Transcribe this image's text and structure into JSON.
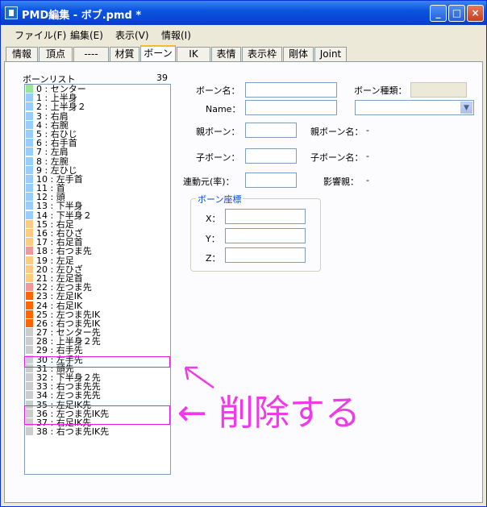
{
  "window": {
    "title": "PMD編集 - ボブ.pmd *",
    "minimize": "_",
    "maximize": "□",
    "close": "×"
  },
  "menu": [
    "ファイル(F)",
    "編集(E)",
    "表示(V)",
    "情報(I)"
  ],
  "tabs": [
    "情報",
    "頂点",
    "----",
    "材質",
    "ボーン",
    "IK",
    "表情",
    "表示枠",
    "剛体",
    "Joint"
  ],
  "active_tab": "ボーン",
  "bone_list": {
    "header": "ボーンリスト",
    "count": "39",
    "items": [
      {
        "label": "0 : センター",
        "color": "#99e699"
      },
      {
        "label": "1 : 上半身",
        "color": "#99ccff"
      },
      {
        "label": "2 : 上半身２",
        "color": "#99ccff"
      },
      {
        "label": "3 : 右肩",
        "color": "#99ccff"
      },
      {
        "label": "4 : 右腕",
        "color": "#99ccff"
      },
      {
        "label": "5 : 右ひじ",
        "color": "#99ccff"
      },
      {
        "label": "6 : 右手首",
        "color": "#99ccff"
      },
      {
        "label": "7 : 左肩",
        "color": "#99ccff"
      },
      {
        "label": "8 : 左腕",
        "color": "#99ccff"
      },
      {
        "label": "9 : 左ひじ",
        "color": "#99ccff"
      },
      {
        "label": "10 : 左手首",
        "color": "#99ccff"
      },
      {
        "label": "11 : 首",
        "color": "#99ccff"
      },
      {
        "label": "12 : 頭",
        "color": "#99ccff"
      },
      {
        "label": "13 : 下半身",
        "color": "#99ccff"
      },
      {
        "label": "14 : 下半身２",
        "color": "#99ccff"
      },
      {
        "label": "15 : 右足",
        "color": "#ffcc80"
      },
      {
        "label": "16 : 右ひざ",
        "color": "#ffcc80"
      },
      {
        "label": "17 : 右足首",
        "color": "#ffcc80"
      },
      {
        "label": "18 : 右つま先",
        "color": "#f09999"
      },
      {
        "label": "19 : 左足",
        "color": "#ffcc80"
      },
      {
        "label": "20 : 左ひざ",
        "color": "#ffcc80"
      },
      {
        "label": "21 : 左足首",
        "color": "#ffcc80"
      },
      {
        "label": "22 : 左つま先",
        "color": "#f09999"
      },
      {
        "label": "23 : 左足IK",
        "color": "#ff6600"
      },
      {
        "label": "24 : 右足IK",
        "color": "#ff6600"
      },
      {
        "label": "25 : 左つま先IK",
        "color": "#ff6600"
      },
      {
        "label": "26 : 右つま先IK",
        "color": "#ff6600"
      },
      {
        "label": "27 : センター先",
        "color": "#cccccc"
      },
      {
        "label": "28 : 上半身２先",
        "color": "#cccccc"
      },
      {
        "label": "29 : 右手先",
        "color": "#cccccc"
      },
      {
        "label": "30 : 左手先",
        "color": "#cccccc"
      },
      {
        "label": "31 : 頭先",
        "color": "#cccccc"
      },
      {
        "label": "32 : 下半身２先",
        "color": "#cccccc"
      },
      {
        "label": "33 : 右つま先先",
        "color": "#cccccc"
      },
      {
        "label": "34 : 左つま先先",
        "color": "#cccccc"
      },
      {
        "label": "35 : 左足IK先",
        "color": "#cccccc"
      },
      {
        "label": "36 : 左つま先IK先",
        "color": "#cccccc"
      },
      {
        "label": "37 : 右足IK先",
        "color": "#cccccc"
      },
      {
        "label": "38 : 右つま先IK先",
        "color": "#cccccc"
      }
    ]
  },
  "form": {
    "bone_name_label": "ボーン名：",
    "bone_name_value": "",
    "bone_type_label": "ボーン種類：",
    "name_label": "Name：",
    "name_value": "",
    "parent_label": "親ボーン：",
    "parent_name_label": "親ボーン名：",
    "parent_name_value": "-",
    "child_label": "子ボーン：",
    "child_name_label": "子ボーン名：",
    "child_name_value": "-",
    "link_label": "連動元(率)：",
    "influence_label": "影響親：",
    "influence_value": "-",
    "coords_title": "ボーン座標",
    "x_label": "X：",
    "y_label": "Y：",
    "z_label": "Z："
  },
  "annotation": {
    "arrow_up": "↖",
    "delete_text": "← 削除する"
  }
}
